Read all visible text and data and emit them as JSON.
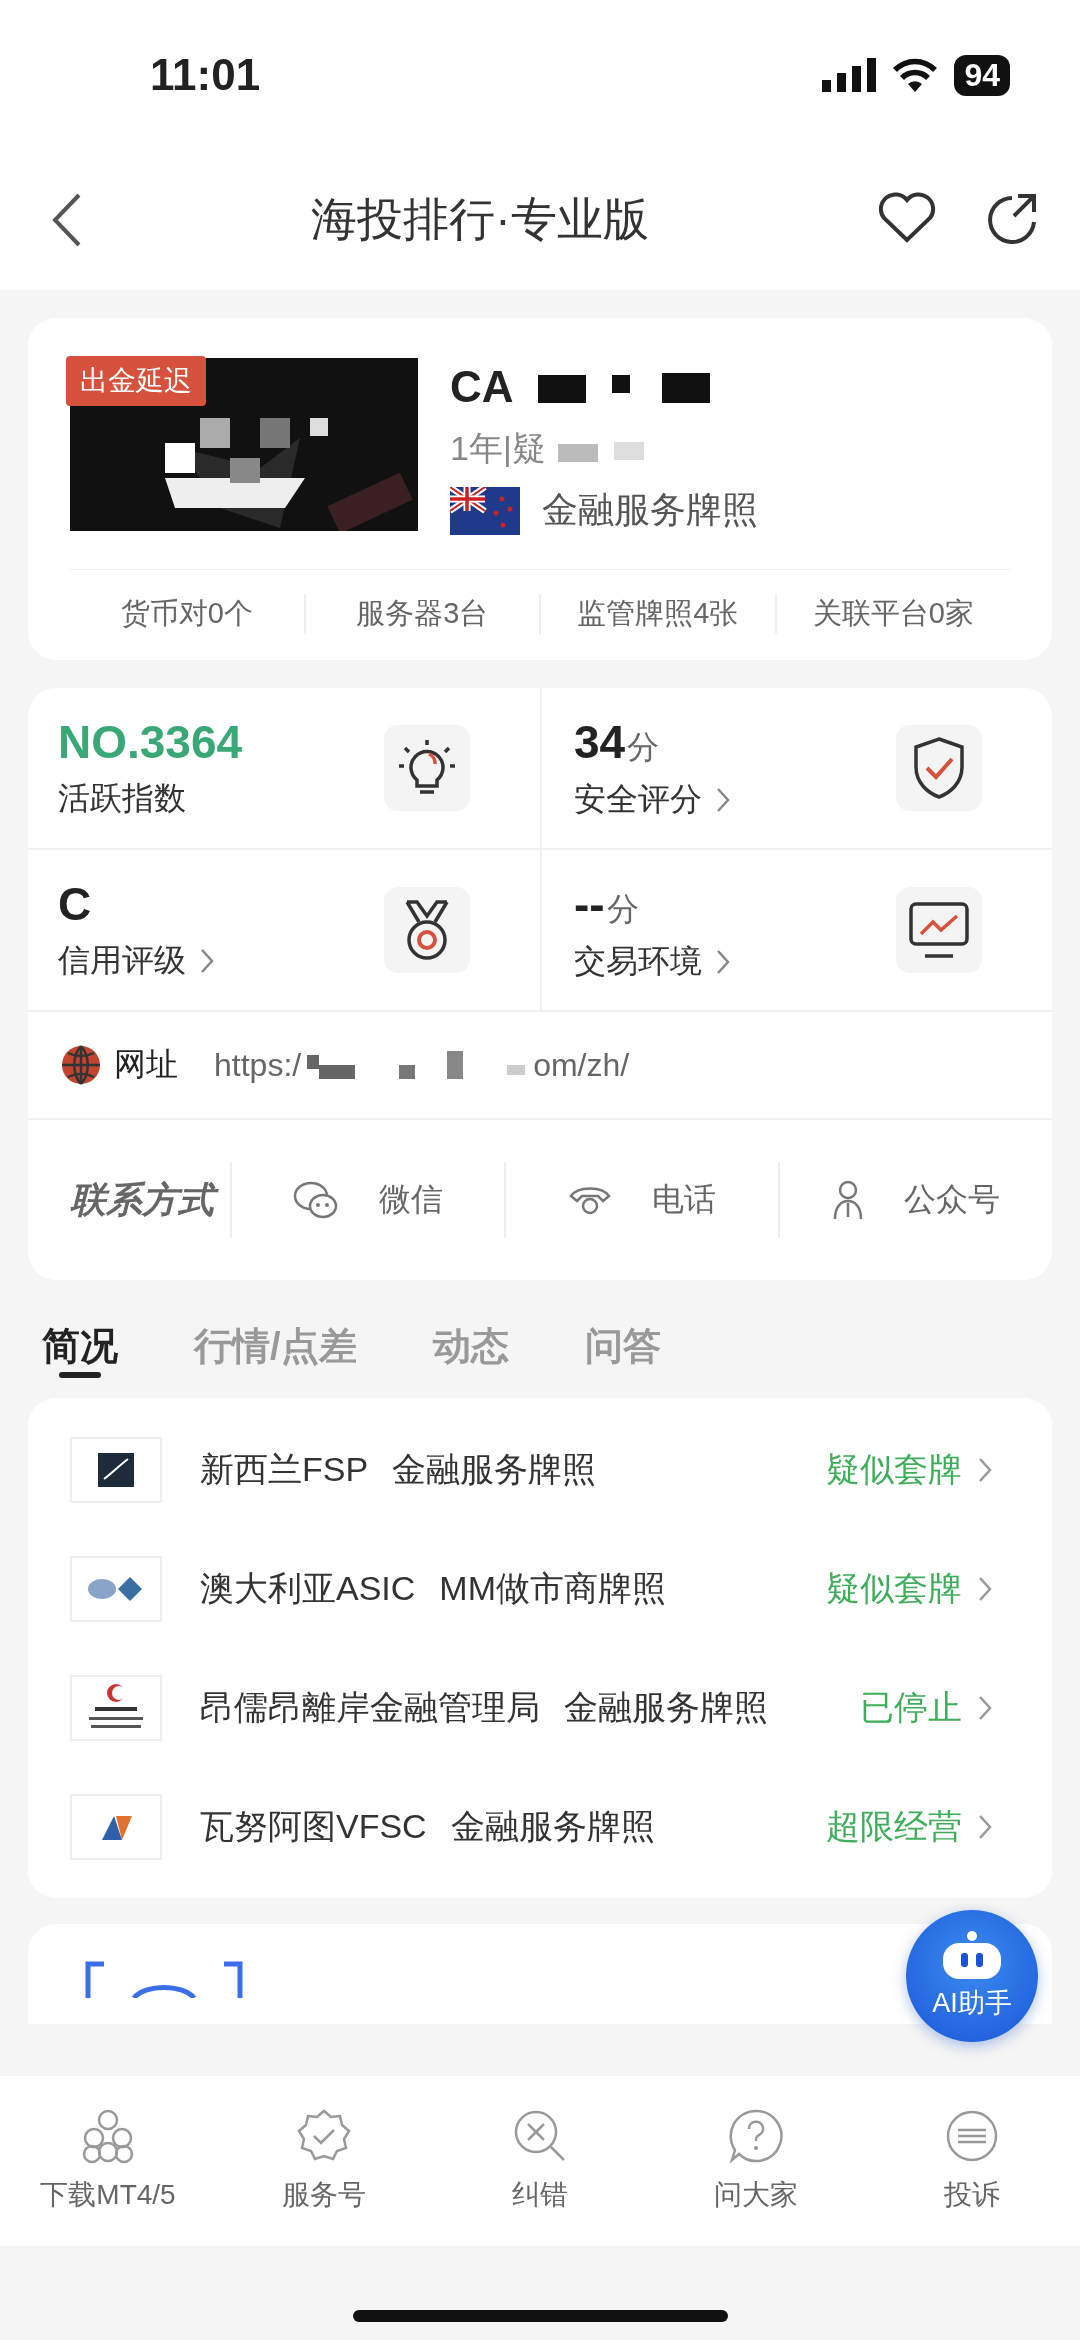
{
  "status_bar": {
    "time": "11:01",
    "battery": "94"
  },
  "header": {
    "title": "海投排行·专业版"
  },
  "broker": {
    "badge": "出金延迟",
    "name": "CA",
    "meta": "1年|疑",
    "license": "金融服务牌照",
    "stats": [
      "货币对0个",
      "服务器3台",
      "监管牌照4张",
      "关联平台0家"
    ]
  },
  "scores": [
    {
      "kind": "activity",
      "value": "NO.3364",
      "label": "活跃指数",
      "link": false
    },
    {
      "kind": "safety",
      "value": "34",
      "unit": "分",
      "label": "安全评分",
      "link": true
    },
    {
      "kind": "credit",
      "value": "C",
      "label": "信用评级",
      "link": true
    },
    {
      "kind": "trading",
      "value": "--",
      "unit": "分",
      "label": "交易环境",
      "link": true
    }
  ],
  "website": {
    "label": "网址",
    "url_start": "https:/",
    "url_end": "om/zh/"
  },
  "contact": {
    "label": "联系方式",
    "items": [
      {
        "kind": "wechat",
        "label": "微信"
      },
      {
        "kind": "phone",
        "label": "电话"
      },
      {
        "kind": "account",
        "label": "公众号"
      }
    ]
  },
  "tabs": [
    {
      "label": "简况",
      "selected": true
    },
    {
      "label": "行情/点差",
      "selected": false
    },
    {
      "label": "动态",
      "selected": false
    },
    {
      "label": "问答",
      "selected": false
    }
  ],
  "licenses": [
    {
      "kind": "nz",
      "regulator": "新西兰FSP",
      "type": "金融服务牌照",
      "status": "疑似套牌"
    },
    {
      "kind": "asic",
      "regulator": "澳大利亚ASIC",
      "type": "MM做市商牌照",
      "status": "疑似套牌"
    },
    {
      "kind": "aofa",
      "regulator": "昂儒昂離岸金融管理局",
      "type": "金融服务牌照",
      "status": "已停止"
    },
    {
      "kind": "vfsc",
      "regulator": "瓦努阿图VFSC",
      "type": "金融服务牌照",
      "status": "超限经营"
    }
  ],
  "assistant": {
    "label": "AI助手"
  },
  "nav": [
    {
      "kind": "mt",
      "label": "下载MT4/5"
    },
    {
      "kind": "service",
      "label": "服务号"
    },
    {
      "kind": "correct",
      "label": "纠错"
    },
    {
      "kind": "ask",
      "label": "问大家"
    },
    {
      "kind": "complain",
      "label": "投诉"
    }
  ]
}
